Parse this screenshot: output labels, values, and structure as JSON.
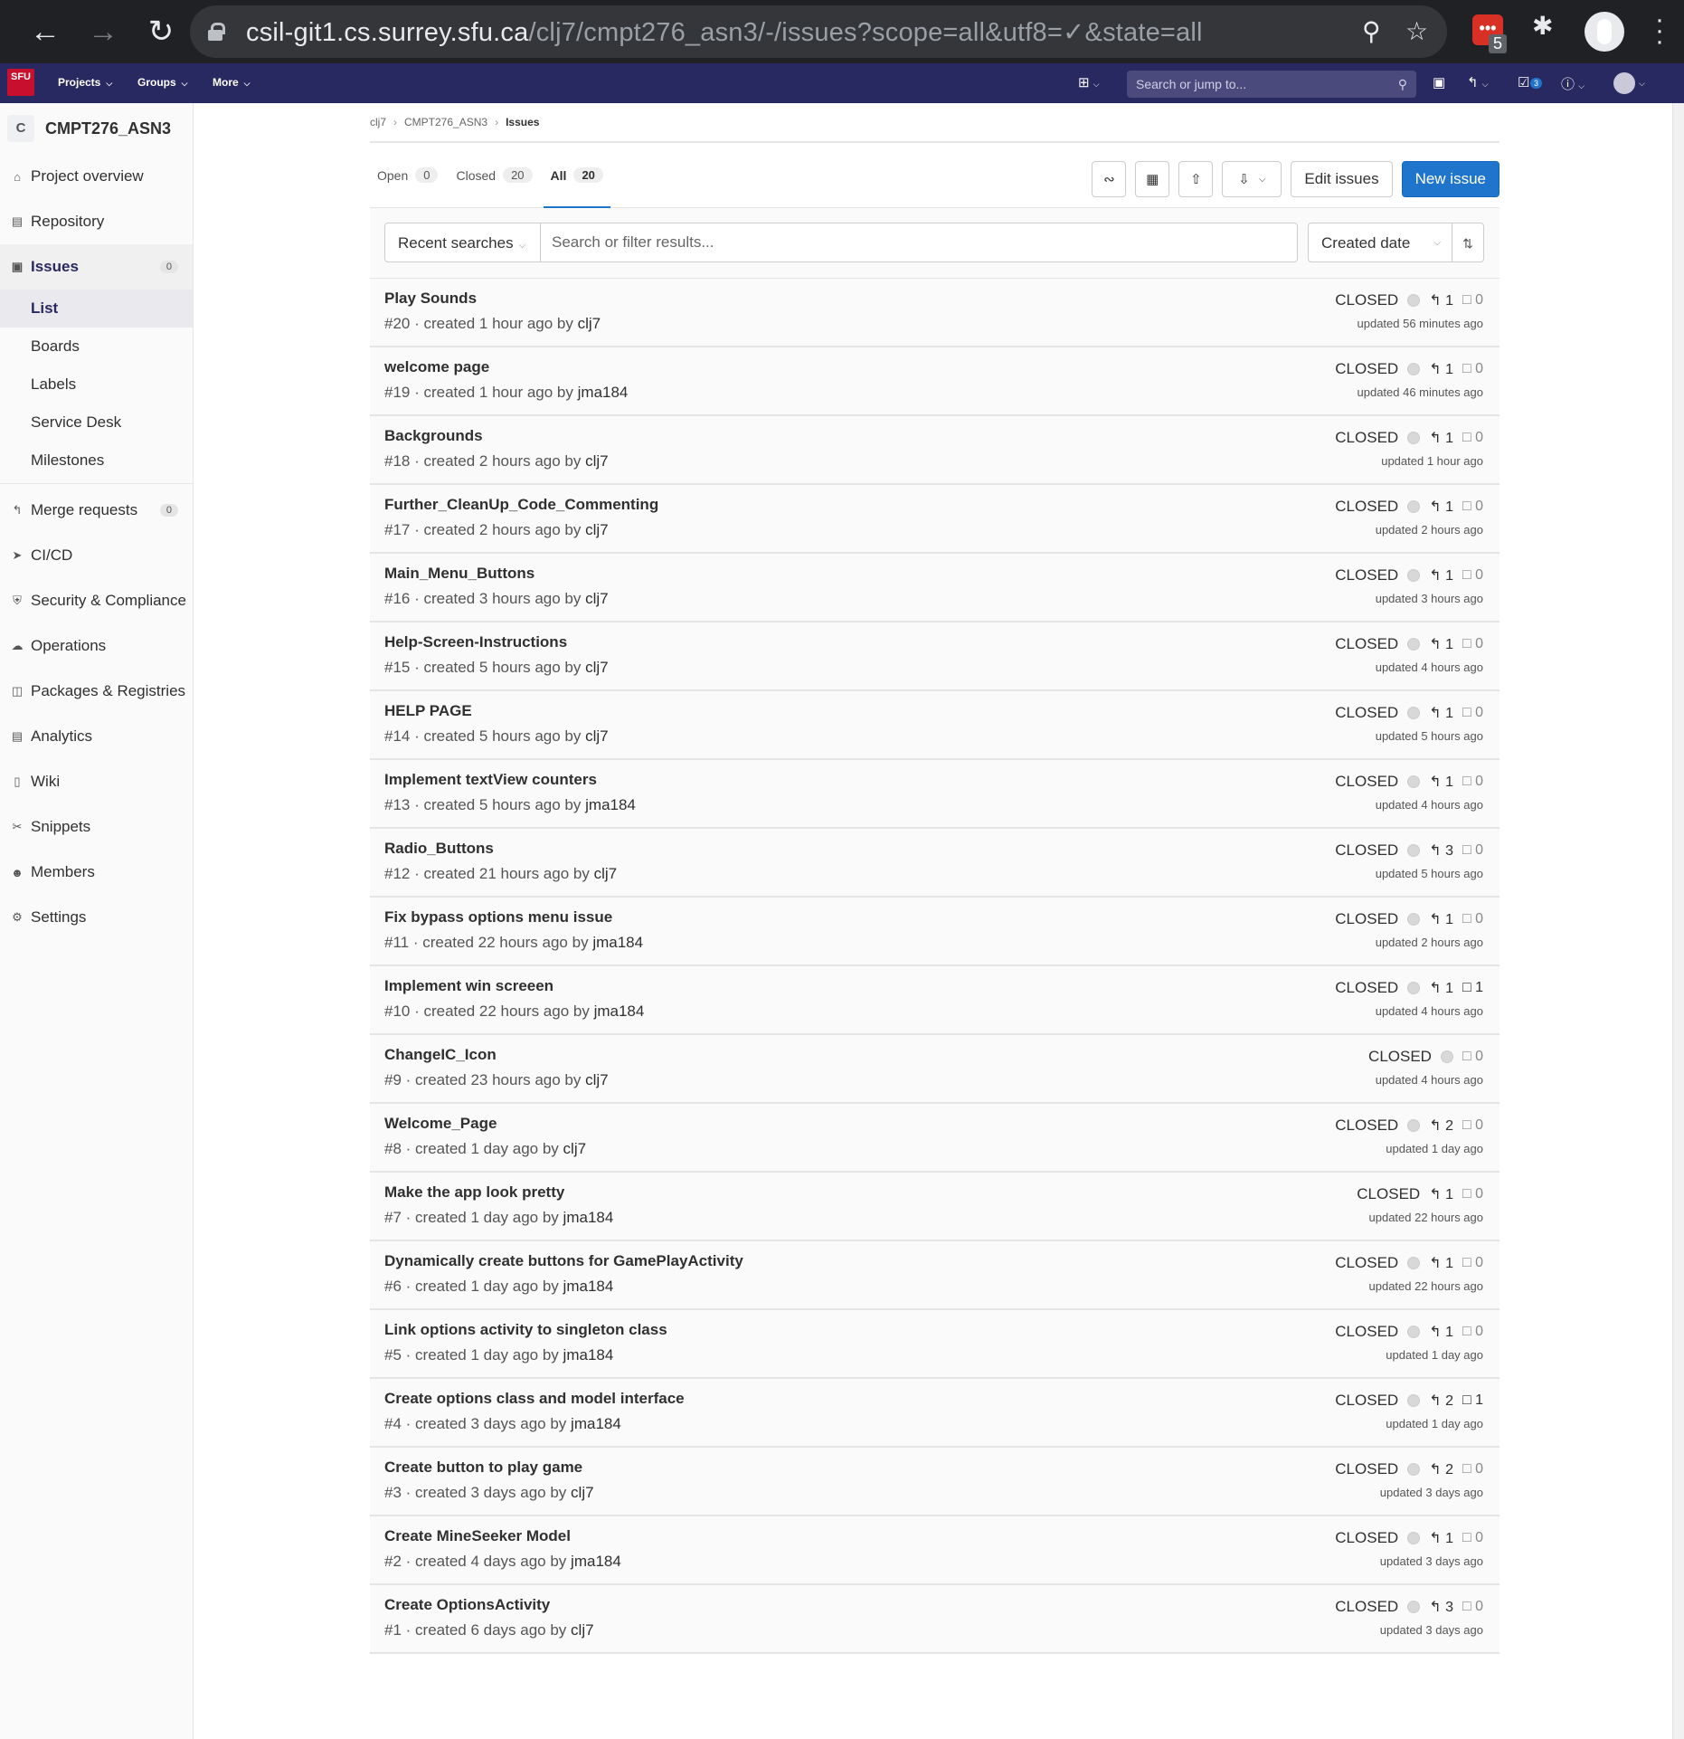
{
  "browser": {
    "url_host": "csil-git1.cs.surrey.sfu.ca",
    "url_path": "/clj7/cmpt276_asn3/-/issues?scope=all&utf8=✓&state=all",
    "extension_badge": "5"
  },
  "topbar": {
    "logo": "SFU",
    "projects": "Projects",
    "groups": "Groups",
    "more": "More",
    "search_placeholder": "Search or jump to...",
    "todo_count": "3"
  },
  "sidebar": {
    "project_initial": "C",
    "project_name": "CMPT276_ASN3",
    "items": [
      {
        "label": "Project overview",
        "icon": "home-icon"
      },
      {
        "label": "Repository",
        "icon": "doc-icon"
      },
      {
        "label": "Issues",
        "icon": "issues-icon",
        "count": "0"
      },
      {
        "label": "Merge requests",
        "icon": "merge-request-icon",
        "count": "0"
      },
      {
        "label": "CI/CD",
        "icon": "rocket-icon"
      },
      {
        "label": "Security & Compliance",
        "icon": "shield-icon"
      },
      {
        "label": "Operations",
        "icon": "cloud-icon"
      },
      {
        "label": "Packages & Registries",
        "icon": "package-icon"
      },
      {
        "label": "Analytics",
        "icon": "chart-icon"
      },
      {
        "label": "Wiki",
        "icon": "book-icon"
      },
      {
        "label": "Snippets",
        "icon": "scissors-icon"
      },
      {
        "label": "Members",
        "icon": "users-icon"
      },
      {
        "label": "Settings",
        "icon": "gear-icon"
      }
    ],
    "issues_sub": [
      "List",
      "Boards",
      "Labels",
      "Service Desk",
      "Milestones"
    ]
  },
  "breadcrumb": [
    "clj7",
    "CMPT276_ASN3",
    "Issues"
  ],
  "tabs": [
    {
      "label": "Open",
      "count": "0"
    },
    {
      "label": "Closed",
      "count": "20"
    },
    {
      "label": "All",
      "count": "20"
    }
  ],
  "actions": {
    "edit": "Edit issues",
    "new": "New issue"
  },
  "filter": {
    "recent": "Recent searches",
    "placeholder": "Search or filter results...",
    "sort": "Created date"
  },
  "issues": [
    {
      "title": "Play Sounds",
      "ref": "#20",
      "created": "created 1 hour ago by",
      "author": "clj7",
      "state": "CLOSED",
      "mrs": "1",
      "comments": "0",
      "updated": "updated 56 minutes ago"
    },
    {
      "title": "welcome page",
      "ref": "#19",
      "created": "created 1 hour ago by",
      "author": "jma184",
      "state": "CLOSED",
      "mrs": "1",
      "comments": "0",
      "updated": "updated 46 minutes ago"
    },
    {
      "title": "Backgrounds",
      "ref": "#18",
      "created": "created 2 hours ago by",
      "author": "clj7",
      "state": "CLOSED",
      "mrs": "1",
      "comments": "0",
      "updated": "updated 1 hour ago"
    },
    {
      "title": "Further_CleanUp_Code_Commenting",
      "ref": "#17",
      "created": "created 2 hours ago by",
      "author": "clj7",
      "state": "CLOSED",
      "mrs": "1",
      "comments": "0",
      "updated": "updated 2 hours ago"
    },
    {
      "title": "Main_Menu_Buttons",
      "ref": "#16",
      "created": "created 3 hours ago by",
      "author": "clj7",
      "state": "CLOSED",
      "mrs": "1",
      "comments": "0",
      "updated": "updated 3 hours ago"
    },
    {
      "title": "Help-Screen-Instructions",
      "ref": "#15",
      "created": "created 5 hours ago by",
      "author": "clj7",
      "state": "CLOSED",
      "mrs": "1",
      "comments": "0",
      "updated": "updated 4 hours ago"
    },
    {
      "title": "HELP PAGE",
      "ref": "#14",
      "created": "created 5 hours ago by",
      "author": "clj7",
      "state": "CLOSED",
      "mrs": "1",
      "comments": "0",
      "updated": "updated 5 hours ago"
    },
    {
      "title": "Implement textView counters",
      "ref": "#13",
      "created": "created 5 hours ago by",
      "author": "jma184",
      "state": "CLOSED",
      "mrs": "1",
      "comments": "0",
      "updated": "updated 4 hours ago"
    },
    {
      "title": "Radio_Buttons",
      "ref": "#12",
      "created": "created 21 hours ago by",
      "author": "clj7",
      "state": "CLOSED",
      "mrs": "3",
      "comments": "0",
      "updated": "updated 5 hours ago"
    },
    {
      "title": "Fix bypass options menu issue",
      "ref": "#11",
      "created": "created 22 hours ago by",
      "author": "jma184",
      "state": "CLOSED",
      "mrs": "1",
      "comments": "0",
      "updated": "updated 2 hours ago"
    },
    {
      "title": "Implement win screeen",
      "ref": "#10",
      "created": "created 22 hours ago by",
      "author": "jma184",
      "state": "CLOSED",
      "mrs": "1",
      "comments": "1",
      "updated": "updated 4 hours ago"
    },
    {
      "title": "ChangeIC_Icon",
      "ref": "#9",
      "created": "created 23 hours ago by",
      "author": "clj7",
      "state": "CLOSED",
      "mrs": "",
      "comments": "0",
      "updated": "updated 4 hours ago"
    },
    {
      "title": "Welcome_Page",
      "ref": "#8",
      "created": "created 1 day ago by",
      "author": "clj7",
      "state": "CLOSED",
      "mrs": "2",
      "comments": "0",
      "updated": "updated 1 day ago"
    },
    {
      "title": "Make the app look pretty",
      "ref": "#7",
      "created": "created 1 day ago by",
      "author": "jma184",
      "state": "CLOSED",
      "mrs": "1",
      "comments": "0",
      "updated": "updated 22 hours ago",
      "no_assignee": true
    },
    {
      "title": "Dynamically create buttons for GamePlayActivity",
      "ref": "#6",
      "created": "created 1 day ago by",
      "author": "jma184",
      "state": "CLOSED",
      "mrs": "1",
      "comments": "0",
      "updated": "updated 22 hours ago"
    },
    {
      "title": "Link options activity to singleton class",
      "ref": "#5",
      "created": "created 1 day ago by",
      "author": "jma184",
      "state": "CLOSED",
      "mrs": "1",
      "comments": "0",
      "updated": "updated 1 day ago"
    },
    {
      "title": "Create options class and model interface",
      "ref": "#4",
      "created": "created 3 days ago by",
      "author": "jma184",
      "state": "CLOSED",
      "mrs": "2",
      "comments": "1",
      "updated": "updated 1 day ago"
    },
    {
      "title": "Create button to play game",
      "ref": "#3",
      "created": "created 3 days ago by",
      "author": "clj7",
      "state": "CLOSED",
      "mrs": "2",
      "comments": "0",
      "updated": "updated 3 days ago"
    },
    {
      "title": "Create MineSeeker Model",
      "ref": "#2",
      "created": "created 4 days ago by",
      "author": "jma184",
      "state": "CLOSED",
      "mrs": "1",
      "comments": "0",
      "updated": "updated 3 days ago"
    },
    {
      "title": "Create OptionsActivity",
      "ref": "#1",
      "created": "created 6 days ago by",
      "author": "clj7",
      "state": "CLOSED",
      "mrs": "3",
      "comments": "0",
      "updated": "updated 3 days ago"
    }
  ]
}
